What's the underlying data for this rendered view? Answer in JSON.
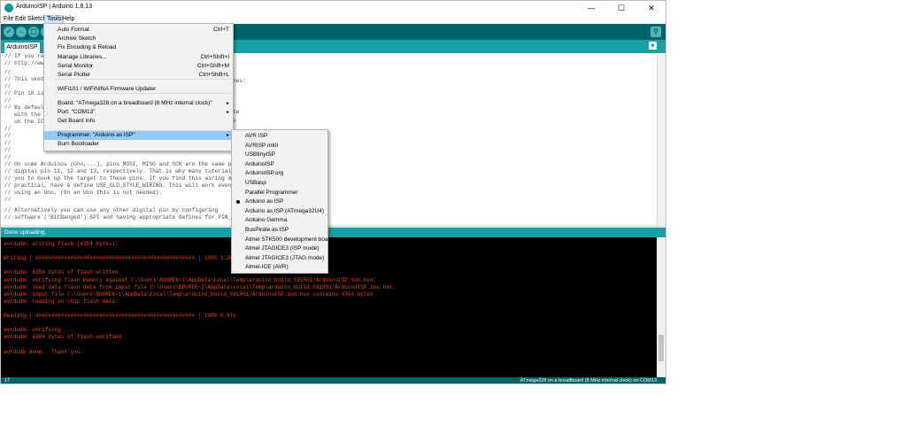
{
  "window": {
    "title": "ArduinoISP | Arduino 1.8.13",
    "controls": [
      "—",
      "☐",
      "✕"
    ]
  },
  "menubar": [
    "File",
    "Edit",
    "Sketch",
    "Tools",
    "Help"
  ],
  "toolbar": {
    "verify": "✓",
    "upload": "→",
    "new": "▢",
    "open": "↑",
    "save": "↓",
    "serial_monitor": "⚲",
    "tab_menu": "▾"
  },
  "tab": {
    "label": "ArduinoISP"
  },
  "editor_lines": [
    "// If you req",
    "// http://www",
    "//",
    "// This sketc",
    "//",
    "// Pin 10 is",
    "//",
    "// By default",
    "   with the t",
    "   on the ICS",
    "//",
    "//",
    "//",
    "//                 . . GND",
    "//",
    "// On some Arduinos (Uno,...), pins MOSI, MISO and SCK are the same pins as",
    "// digital pin 11, 12 and 13, respectively. That is why many tutorials instr",
    "// you to hook up the target to these pins. If you find this wiring more",
    "// practical, have a define USE_OLD_STYLE_WIRING. This will work even when n",
    "// using an Uno. (On an Uno this is not needed).",
    "//",
    "// Alternatively you can use any other digital pin by configuring",
    "// software ('BitBanged') SPI and having appropriate defines for PIN_MOSI,"
  ],
  "editor_right_fragments": [
    "nes:",
    "te",
    "e"
  ],
  "status": "Done uploading.",
  "console_lines": [
    "avrdude: writing flash (4354 bytes):",
    "",
    "Writing | ################################################## | 100% 1.30s",
    "",
    "avrdude: 4354 bytes of flash written",
    "avrdude: verifying flash memory against C:\\Users\\BOUREK~1\\AppData\\Local\\Temp\\arduino_build_591501/ArduinoISP.ino.hex:",
    "avrdude: load data flash data from input file C:\\Users\\BOUREK~1\\AppData\\Local\\Temp\\arduino_build_591501/ArduinoISP.ino.hex:",
    "avrdude: input file C:\\Users\\BOUREK~1\\AppData\\Local\\Temp\\arduino_build_591501/ArduinoISP.ino.hex contains 4354 bytes",
    "avrdude: reading on-chip flash data:",
    "",
    "Reading | ################################################## | 100% 0.97s",
    "",
    "avrdude: verifying ...",
    "avrdude: 4354 bytes of flash verified",
    "",
    "avrdude done.  Thank you."
  ],
  "bottombar": {
    "line": "17",
    "board_info": "ATmega328 on a breadboard (8 MHz internal clock) on COM13"
  },
  "tools_menu": [
    {
      "label": "Auto Format",
      "shortcut": "Ctrl+T"
    },
    {
      "label": "Archive Sketch",
      "shortcut": ""
    },
    {
      "label": "Fix Encoding & Reload",
      "shortcut": ""
    },
    {
      "label": "Manage Libraries...",
      "shortcut": "Ctrl+Shift+I"
    },
    {
      "label": "Serial Monitor",
      "shortcut": "Ctrl+Shift+M"
    },
    {
      "label": "Serial Plotter",
      "shortcut": "Ctrl+Shift+L"
    },
    {
      "label": "WiFi101 / WiFiNINA Firmware Updater",
      "shortcut": ""
    },
    {
      "label": "Board: \"ATmega328 on a breadboard (8 MHz internal clock)\"",
      "shortcut": ""
    },
    {
      "label": "Port: \"COM13\"",
      "shortcut": ""
    },
    {
      "label": "Get Board Info",
      "shortcut": ""
    },
    {
      "label": "Programmer: \"Arduino as ISP\"",
      "shortcut": ""
    },
    {
      "label": "Burn Bootloader",
      "shortcut": ""
    }
  ],
  "programmer_menu": [
    "AVR ISP",
    "AVRISP mkII",
    "USBtinyISP",
    "ArduinoISP",
    "ArduinoISP.org",
    "USBasp",
    "Parallel Programmer",
    "Arduino as ISP",
    "Arduino as ISP (ATmega32U4)",
    "Arduino Gemma",
    "BusPirate as ISP",
    "Atmel STK500 development board",
    "Atmel JTAGICE3 (ISP mode)",
    "Atmel JTAGICE3 (JTAG mode)",
    "Atmel-ICE (AVR)"
  ],
  "colors": {
    "toolbar": "#006468",
    "tabstrip": "#17a1a5",
    "console_text": "#e34c00",
    "menu_highlight": "#91c9f7"
  }
}
